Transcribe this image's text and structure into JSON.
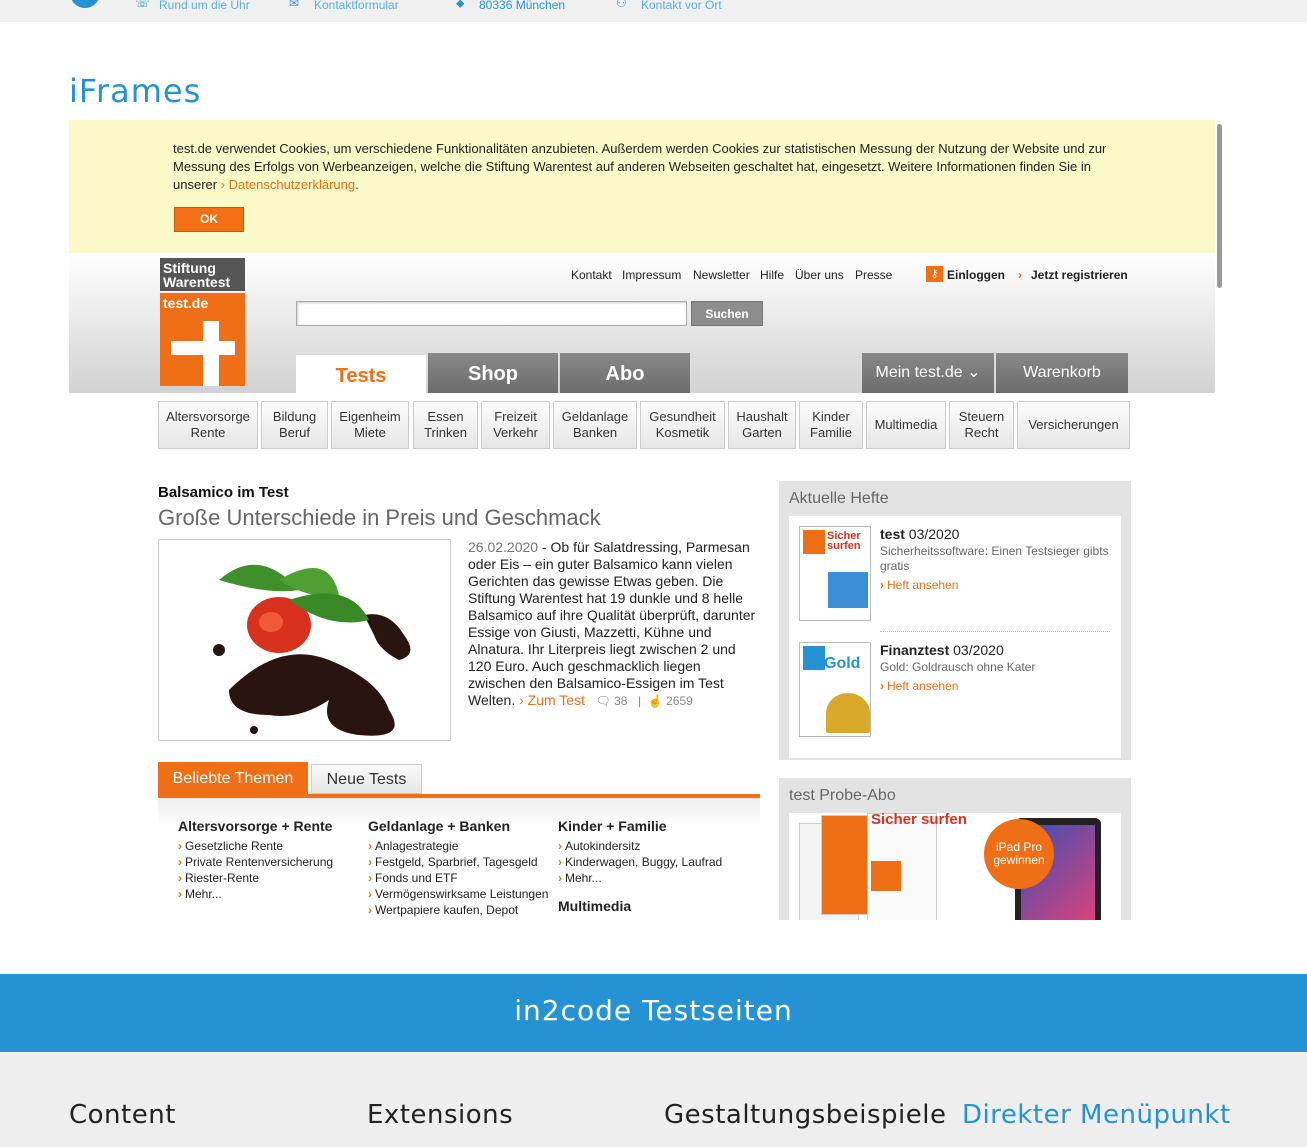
{
  "topbar": {
    "items": [
      "Rund um die Uhr",
      "Kontaktformular",
      "80336 München",
      "Kontakt vor Ort"
    ]
  },
  "page": {
    "title": "iFrames"
  },
  "cookie": {
    "text": "test.de verwendet Cookies, um verschiedene Funktionalitäten anzubieten. Außerdem werden Cookies zur statistischen Messung der Nutzung der Website und zur Messung des Erfolgs von Werbeanzeigen, welche die Stiftung Warentest auf anderen Webseiten geschaltet hat, eingesetzt. Weitere Informationen finden Sie in unserer ",
    "link": "Datenschutzerklärung",
    "ok": "OK"
  },
  "header": {
    "logo_top": "Stiftung Warentest",
    "logo_bottom": "test.de",
    "links": [
      "Kontakt",
      "Impressum",
      "Newsletter",
      "Hilfe",
      "Über uns",
      "Presse"
    ],
    "login": "Einloggen",
    "register": "Jetzt registrieren",
    "search_button": "Suchen",
    "tabs": [
      "Tests",
      "Shop",
      "Abo"
    ],
    "mein": "Mein test.de",
    "warenkorb": "Warenkorb"
  },
  "categories": [
    [
      "Altersvorsorge",
      "Rente"
    ],
    [
      "Bildung",
      "Beruf"
    ],
    [
      "Eigenheim",
      "Miete"
    ],
    [
      "Essen",
      "Trinken"
    ],
    [
      "Freizeit",
      "Verkehr"
    ],
    [
      "Geldanlage",
      "Banken"
    ],
    [
      "Gesundheit",
      "Kosmetik"
    ],
    [
      "Haushalt",
      "Garten"
    ],
    [
      "Kinder",
      "Familie"
    ],
    [
      "Multimedia",
      ""
    ],
    [
      "Steuern",
      "Recht"
    ],
    [
      "Versicherungen",
      ""
    ]
  ],
  "article": {
    "kicker": "Balsamico im Test",
    "title": "Große Unterschiede in Preis und Geschmack",
    "date": "26.02.2020",
    "body": " - Ob für Salatdressing, Parmesan oder Eis – ein guter Balsamico kann vielen Gerichten das gewisse Etwas geben. Die Stiftung Warentest hat 19 dunkle und 8 helle Balsamico auf ihre Qualität überprüft, darunter Essige von Giusti, Mazzetti, Kühne und Alnatura. Ihr Literpreis liegt zwischen 2 und 120 Euro. Auch geschmacklich liegen zwischen den Balsamico-Essigen im Test Welten. ",
    "link": "Zum Test",
    "comments": "38",
    "likes": "2659"
  },
  "themes": {
    "tabs": [
      "Beliebte Themen",
      "Neue Tests"
    ],
    "columns": [
      {
        "title": "Altersvorsorge + Rente",
        "items": [
          "Gesetzliche Rente",
          "Private Rentenversicherung",
          "Riester-Rente"
        ],
        "more": "Mehr..."
      },
      {
        "title": "Geldanlage + Banken",
        "items": [
          "Anlagestrategie",
          "Festgeld, Sparbrief, Tagesgeld",
          "Fonds und ETF",
          "Vermögenswirksame Leistungen",
          "Wertpapiere kaufen, Depot"
        ],
        "more": ""
      },
      {
        "title": "Kinder + Familie",
        "items": [
          "Autokindersitz",
          "Kinderwagen, Buggy, Laufrad"
        ],
        "more": "Mehr...",
        "next_title": "Multimedia"
      }
    ]
  },
  "sidebar": {
    "hefte_title": "Aktuelle Hefte",
    "mag1": {
      "name": "test",
      "issue": " 03/2020",
      "desc": "Sicherheitssoftware: Einen Testsieger gibts gratis",
      "link": "Heft ansehen",
      "cover_text": "Sicher surfen"
    },
    "mag2": {
      "name": "Finanztest",
      "issue": " 03/2020",
      "desc": "Gold: Goldrausch ohne Kater",
      "link": "Heft ansehen",
      "cover_text": "Gold"
    },
    "abo_title": "test Probe-Abo",
    "abo_cover": "Sicher surfen",
    "abo_badge": "iPad Pro gewinnen"
  },
  "footer": {
    "band": "in2code Testseiten",
    "cols": [
      "Content",
      "Extensions",
      "Gestaltungsbeispiele",
      "Direkter Menüpunkt"
    ]
  }
}
